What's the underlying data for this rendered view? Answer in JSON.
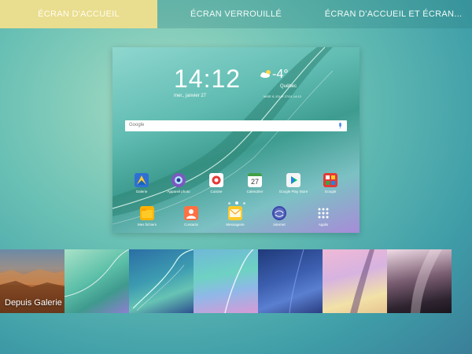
{
  "tabs": [
    {
      "label": "ÉCRAN D'ACCUEIL",
      "active": true
    },
    {
      "label": "ÉCRAN VERROUILLÉ",
      "active": false
    },
    {
      "label": "ÉCRAN D'ACCUEIL ET ÉCRAN...",
      "active": false
    }
  ],
  "preview": {
    "clock": "14:12",
    "date": "mer., janvier 27",
    "temperature": "-4°",
    "city": "Québec",
    "updated": "MISE À JOUR 27/01 14:13",
    "search_placeholder": "Google",
    "apps_row1": [
      {
        "label": "Galerie",
        "icon": "gallery-icon"
      },
      {
        "label": "Appareil photo",
        "icon": "camera-icon"
      },
      {
        "label": "Cuisine",
        "icon": "cooking-icon"
      },
      {
        "label": "Calendrier",
        "icon": "calendar-icon",
        "badge": "27"
      },
      {
        "label": "Google Play Store",
        "icon": "play-store-icon"
      },
      {
        "label": "Google",
        "icon": "google-folder-icon"
      }
    ],
    "apps_row2": [
      {
        "label": "Mes fichiers",
        "icon": "folder-icon"
      },
      {
        "label": "Contacts",
        "icon": "contacts-icon"
      },
      {
        "label": "Messagerie",
        "icon": "messaging-icon"
      },
      {
        "label": "Internet",
        "icon": "internet-icon"
      },
      {
        "label": "Applis",
        "icon": "apps-grid-icon"
      }
    ]
  },
  "wallpapers": [
    {
      "label": "Depuis Galerie"
    }
  ],
  "colors": {
    "active_tab": "#e9dd8f",
    "background": "#69c0b4"
  }
}
